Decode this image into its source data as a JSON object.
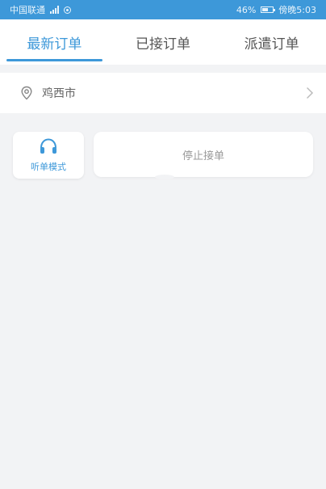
{
  "status_bar": {
    "carrier": "中国联通",
    "battery_percent": "46%",
    "time": "傍晚5:03"
  },
  "tabs": [
    {
      "label": "最新订单",
      "active": true
    },
    {
      "label": "已接订单",
      "active": false
    },
    {
      "label": "派遣订单",
      "active": false
    }
  ],
  "location": {
    "city": "鸡西市"
  },
  "controls": {
    "listen_mode_label": "听单模式",
    "stop_orders_label": "停止接单"
  },
  "icons": {
    "location": "location-pin-icon",
    "headphone": "headphone-icon",
    "chevron": "chevron-right-icon"
  },
  "colors": {
    "accent": "#3d98d9",
    "background": "#f2f3f5",
    "card": "#ffffff"
  }
}
